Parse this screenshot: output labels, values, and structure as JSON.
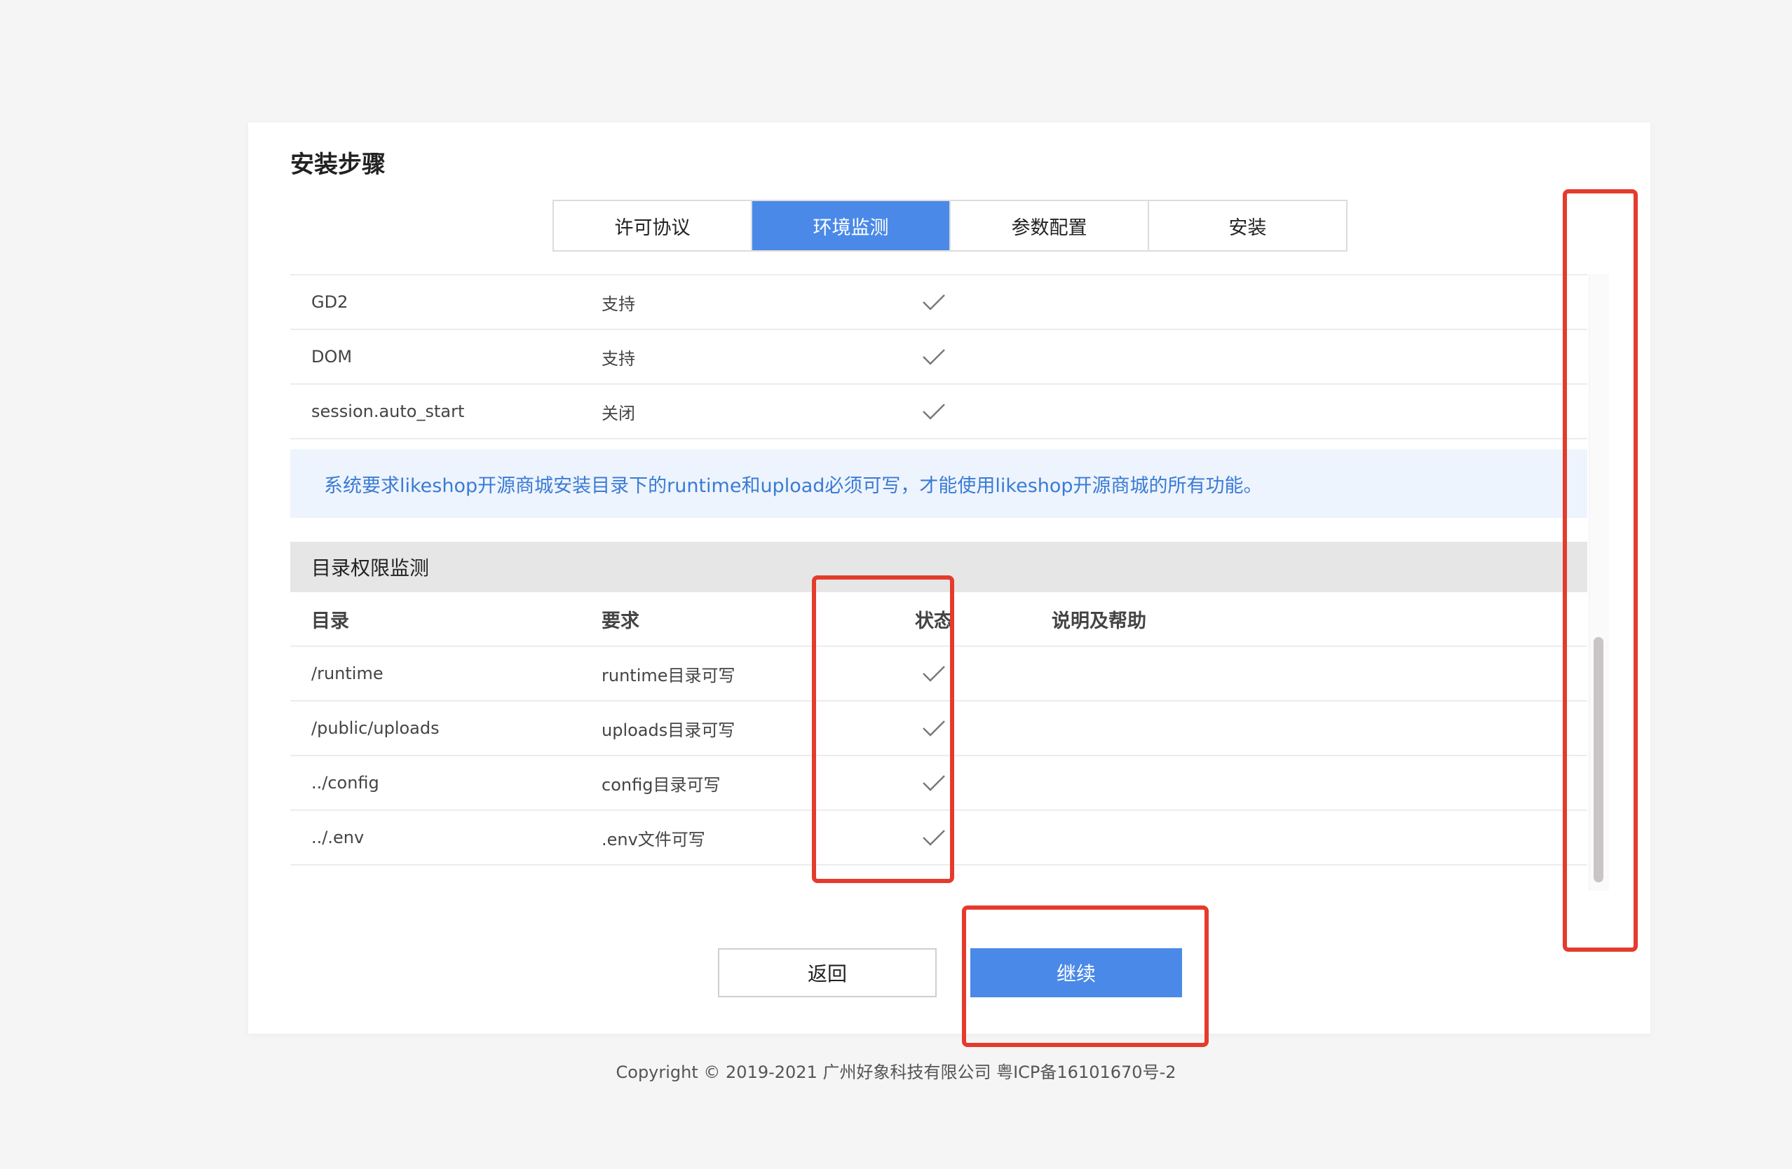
{
  "card": {
    "title": "安装步骤"
  },
  "steps": [
    {
      "label": "许可协议",
      "active": false
    },
    {
      "label": "环境监测",
      "active": true
    },
    {
      "label": "参数配置",
      "active": false
    },
    {
      "label": "安装",
      "active": false
    }
  ],
  "env_rows": [
    {
      "name": "GD2",
      "value": "支持",
      "status": "ok"
    },
    {
      "name": "DOM",
      "value": "支持",
      "status": "ok"
    },
    {
      "name": "session.auto_start",
      "value": "关闭",
      "status": "ok"
    }
  ],
  "notice": "系统要求likeshop开源商城安装目录下的runtime和upload必须可写，才能使用likeshop开源商城的所有功能。",
  "dir_section": {
    "title": "目录权限监测",
    "columns": [
      "目录",
      "要求",
      "状态",
      "说明及帮助"
    ],
    "rows": [
      {
        "dir": "/runtime",
        "requirement": "runtime目录可写",
        "status": "ok"
      },
      {
        "dir": "/public/uploads",
        "requirement": "uploads目录可写",
        "status": "ok"
      },
      {
        "dir": "../config",
        "requirement": "config目录可写",
        "status": "ok"
      },
      {
        "dir": "../.env",
        "requirement": ".env文件可写",
        "status": "ok"
      }
    ]
  },
  "buttons": {
    "back": "返回",
    "next": "继续"
  },
  "colors": {
    "accent": "#4a89e8",
    "highlight": "#e53b2c",
    "notice_text": "#3a7bd5"
  },
  "footer": "Copyright © 2019-2021 广州好象科技有限公司 粤ICP备16101670号-2"
}
